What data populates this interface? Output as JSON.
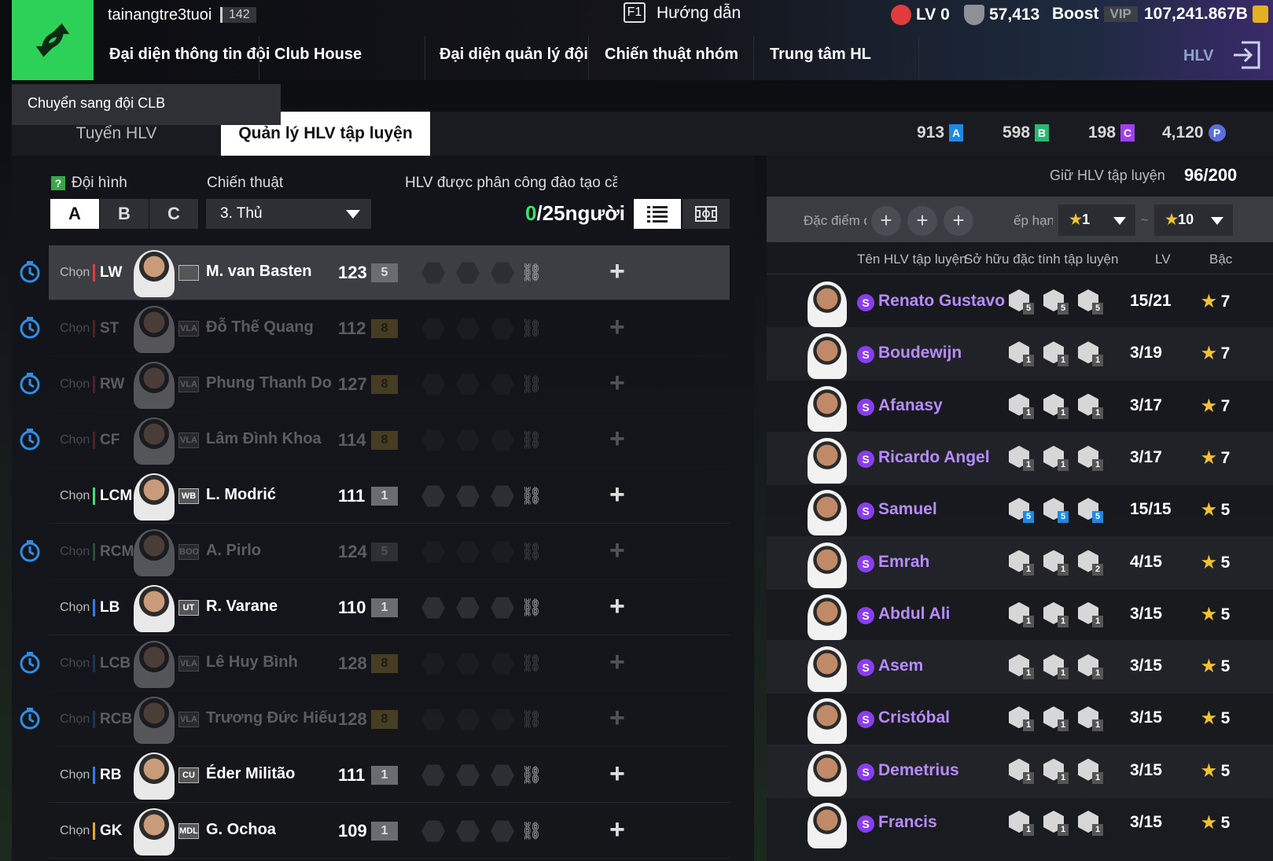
{
  "header": {
    "username": "tainangtre3tuoi",
    "user_level": "142",
    "help_key": "F1",
    "help_label": "Hướng dẫn",
    "lv_label": "LV 0",
    "shield_value": "57,413",
    "boost_label": "Boost",
    "vip_label": "VIP",
    "coins": "107,241.867B"
  },
  "nav": {
    "items": [
      "Đại diện thông tin đội",
      "Club House",
      "Đại diện quản lý đội",
      "Chiến thuật nhóm",
      "Trung tâm HL"
    ],
    "hlv_label": "HLV"
  },
  "tooltip": "Chuyển sang đội CLB",
  "tabs": {
    "recruit": "Tuyển HLV",
    "manage": "Quản lý HLV tập luyện"
  },
  "resources": {
    "a": "913",
    "b": "598",
    "c": "198",
    "p": "4,120"
  },
  "left": {
    "formation_label": "Đội hình",
    "tactic_label": "Chiến thuật",
    "assign_label": "HLV được phân công đào tạo cầu t",
    "formations": [
      "A",
      "B",
      "C"
    ],
    "tactic_value": "3. Thủ",
    "count_zero": "0",
    "count_rest": "/25người",
    "choose_label": "Chọn"
  },
  "players": [
    {
      "pos": "LW",
      "season": "",
      "name": "M. van Basten",
      "ovr": "123",
      "lvl": "5",
      "state": "highlight",
      "timer": true,
      "group": "fw",
      "lvl_color": "gray"
    },
    {
      "pos": "ST",
      "season": "VLA",
      "name": "Đỗ Thế Quang",
      "ovr": "112",
      "lvl": "8",
      "state": "dim",
      "timer": true,
      "group": "fw",
      "lvl_color": "gold"
    },
    {
      "pos": "RW",
      "season": "VLA",
      "name": "Phung Thanh Do",
      "ovr": "127",
      "lvl": "8",
      "state": "dim",
      "timer": true,
      "group": "fw",
      "lvl_color": "gold"
    },
    {
      "pos": "CF",
      "season": "VLA",
      "name": "Lâm Đình Khoa",
      "ovr": "114",
      "lvl": "8",
      "state": "dim",
      "timer": true,
      "group": "fw",
      "lvl_color": "gold"
    },
    {
      "pos": "LCM",
      "season": "WB",
      "name": "L. Modrić",
      "ovr": "111",
      "lvl": "1",
      "state": "normal",
      "timer": false,
      "group": "mf",
      "lvl_color": "gray"
    },
    {
      "pos": "RCM",
      "season": "BOO",
      "name": "A. Pirlo",
      "ovr": "124",
      "lvl": "5",
      "state": "dim",
      "timer": true,
      "group": "mf",
      "lvl_color": "gray"
    },
    {
      "pos": "LB",
      "season": "UT",
      "name": "R. Varane",
      "ovr": "110",
      "lvl": "1",
      "state": "normal",
      "timer": false,
      "group": "df",
      "lvl_color": "gray"
    },
    {
      "pos": "LCB",
      "season": "VLA",
      "name": "Lê Huy Bình",
      "ovr": "128",
      "lvl": "8",
      "state": "dim",
      "timer": true,
      "group": "df",
      "lvl_color": "gold"
    },
    {
      "pos": "RCB",
      "season": "VLA",
      "name": "Trương Đức Hiếu",
      "ovr": "128",
      "lvl": "8",
      "state": "dim",
      "timer": true,
      "group": "df",
      "lvl_color": "gold"
    },
    {
      "pos": "RB",
      "season": "CU",
      "name": "Éder Militão",
      "ovr": "111",
      "lvl": "1",
      "state": "normal",
      "timer": false,
      "group": "df",
      "lvl_color": "gray"
    },
    {
      "pos": "GK",
      "season": "MDL",
      "name": "G. Ochoa",
      "ovr": "109",
      "lvl": "1",
      "state": "normal",
      "timer": false,
      "group": "gk",
      "lvl_color": "gray"
    }
  ],
  "right": {
    "keep_label": "Giữ HLV tập luyện",
    "keep_value": "96/200",
    "trait_filter_label": "Đặc điểm đ",
    "rank_filter_label": "ếp hạng",
    "rank_min": "1",
    "rank_max": "10",
    "tilde": "~",
    "col_name": "Tên HLV tập luyện",
    "col_traits": "Sở hữu đặc tính tập luyện",
    "col_lv": "LV",
    "col_rank": "Bậc"
  },
  "coaches": [
    {
      "name": "Renato Gustavo",
      "lv": "15/21",
      "rank": "7",
      "traits": [
        "5",
        "5",
        "5"
      ],
      "blue": false
    },
    {
      "name": "Boudewijn",
      "lv": "3/19",
      "rank": "7",
      "traits": [
        "1",
        "1",
        "1"
      ],
      "blue": false
    },
    {
      "name": "Afanasy",
      "lv": "3/17",
      "rank": "7",
      "traits": [
        "1",
        "1",
        "1"
      ],
      "blue": false
    },
    {
      "name": "Ricardo Angel",
      "lv": "3/17",
      "rank": "7",
      "traits": [
        "1",
        "1",
        "1"
      ],
      "blue": false
    },
    {
      "name": "Samuel",
      "lv": "15/15",
      "rank": "5",
      "traits": [
        "5",
        "5",
        "5"
      ],
      "blue": true
    },
    {
      "name": "Emrah",
      "lv": "4/15",
      "rank": "5",
      "traits": [
        "1",
        "1",
        "2"
      ],
      "blue": false
    },
    {
      "name": "Abdul Ali",
      "lv": "3/15",
      "rank": "5",
      "traits": [
        "1",
        "1",
        "1"
      ],
      "blue": false
    },
    {
      "name": "Asem",
      "lv": "3/15",
      "rank": "5",
      "traits": [
        "1",
        "1",
        "1"
      ],
      "blue": false
    },
    {
      "name": "Cristóbal",
      "lv": "3/15",
      "rank": "5",
      "traits": [
        "1",
        "1",
        "1"
      ],
      "blue": false
    },
    {
      "name": "Demetrius",
      "lv": "3/15",
      "rank": "5",
      "traits": [
        "1",
        "1",
        "1"
      ],
      "blue": false
    },
    {
      "name": "Francis",
      "lv": "3/15",
      "rank": "5",
      "traits": [
        "1",
        "1",
        "1"
      ],
      "blue": false
    }
  ],
  "colors": {
    "accent_green": "#2ed158",
    "coach_purple": "#b78bff",
    "star_gold": "#f2c230"
  }
}
